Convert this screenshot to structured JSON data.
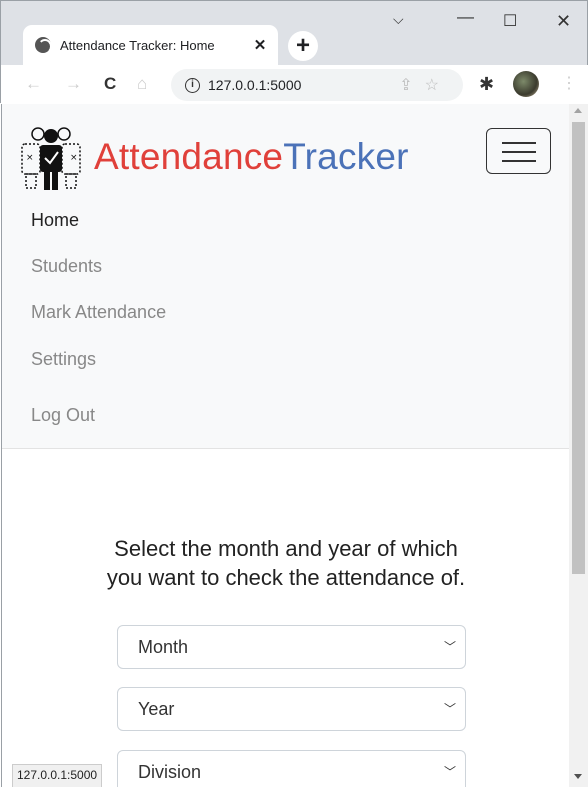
{
  "browser": {
    "tab_title": "Attendance Tracker: Home",
    "tab_close": "✕",
    "new_tab": "+",
    "url": "127.0.0.1:5000",
    "status_url": "127.0.0.1:5000"
  },
  "navbar": {
    "brand_part1": "Attendance",
    "brand_part2": "Tracker",
    "brand_color1": "#e0403a",
    "brand_color2": "#4b72b8",
    "links": [
      {
        "label": "Home",
        "active": true
      },
      {
        "label": "Students",
        "active": false
      },
      {
        "label": "Mark Attendance",
        "active": false
      },
      {
        "label": "Settings",
        "active": false
      },
      {
        "label": "Log Out",
        "active": false
      }
    ]
  },
  "main": {
    "prompt_line1": "Select the month and year of which",
    "prompt_line2": "you want to check the attendance of.",
    "selects": [
      {
        "label": "Month"
      },
      {
        "label": "Year"
      },
      {
        "label": "Division"
      }
    ]
  },
  "icons": [
    "globe-icon",
    "close-icon",
    "plus-icon",
    "minimize-icon",
    "maximize-icon",
    "chevron-down-icon",
    "back-icon",
    "forward-icon",
    "reload-icon",
    "home-icon",
    "info-icon",
    "share-icon",
    "star-icon",
    "puzzle-icon",
    "menu-icon",
    "hamburger-icon",
    "logo-icon"
  ]
}
